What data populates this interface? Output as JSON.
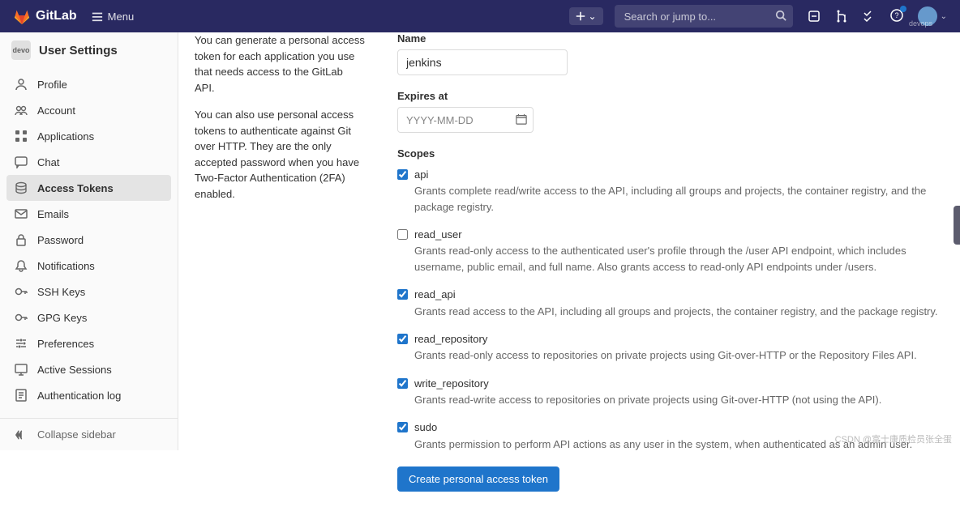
{
  "brand": "GitLab",
  "top_menu_label": "Menu",
  "search": {
    "placeholder": "Search or jump to..."
  },
  "user_name_short": "devops",
  "sidebar": {
    "title": "User Settings",
    "context_label": "devo",
    "items": [
      {
        "label": "Profile",
        "active": false
      },
      {
        "label": "Account",
        "active": false
      },
      {
        "label": "Applications",
        "active": false
      },
      {
        "label": "Chat",
        "active": false
      },
      {
        "label": "Access Tokens",
        "active": true
      },
      {
        "label": "Emails",
        "active": false
      },
      {
        "label": "Password",
        "active": false
      },
      {
        "label": "Notifications",
        "active": false
      },
      {
        "label": "SSH Keys",
        "active": false
      },
      {
        "label": "GPG Keys",
        "active": false
      },
      {
        "label": "Preferences",
        "active": false
      },
      {
        "label": "Active Sessions",
        "active": false
      },
      {
        "label": "Authentication log",
        "active": false
      }
    ],
    "collapse_label": "Collapse sidebar"
  },
  "desc": {
    "p1": "You can generate a personal access token for each application you use that needs access to the GitLab API.",
    "p2": "You can also use personal access tokens to authenticate against Git over HTTP. They are the only accepted password when you have Two-Factor Authentication (2FA) enabled."
  },
  "form": {
    "name_label": "Name",
    "name_value": "jenkins",
    "expires_label": "Expires at",
    "expires_placeholder": "YYYY-MM-DD",
    "scopes_label": "Scopes",
    "submit_label": "Create personal access token"
  },
  "scopes": [
    {
      "key": "api",
      "checked": true,
      "desc": "Grants complete read/write access to the API, including all groups and projects, the container registry, and the package registry."
    },
    {
      "key": "read_user",
      "checked": false,
      "desc": "Grants read-only access to the authenticated user's profile through the /user API endpoint, which includes username, public email, and full name. Also grants access to read-only API endpoints under /users."
    },
    {
      "key": "read_api",
      "checked": true,
      "desc": "Grants read access to the API, including all groups and projects, the container registry, and the package registry."
    },
    {
      "key": "read_repository",
      "checked": true,
      "desc": "Grants read-only access to repositories on private projects using Git-over-HTTP or the Repository Files API."
    },
    {
      "key": "write_repository",
      "checked": true,
      "desc": "Grants read-write access to repositories on private projects using Git-over-HTTP (not using the API)."
    },
    {
      "key": "sudo",
      "checked": true,
      "desc": "Grants permission to perform API actions as any user in the system, when authenticated as an admin user."
    }
  ],
  "watermark": "CSDN @富士康质检员张全蛋"
}
